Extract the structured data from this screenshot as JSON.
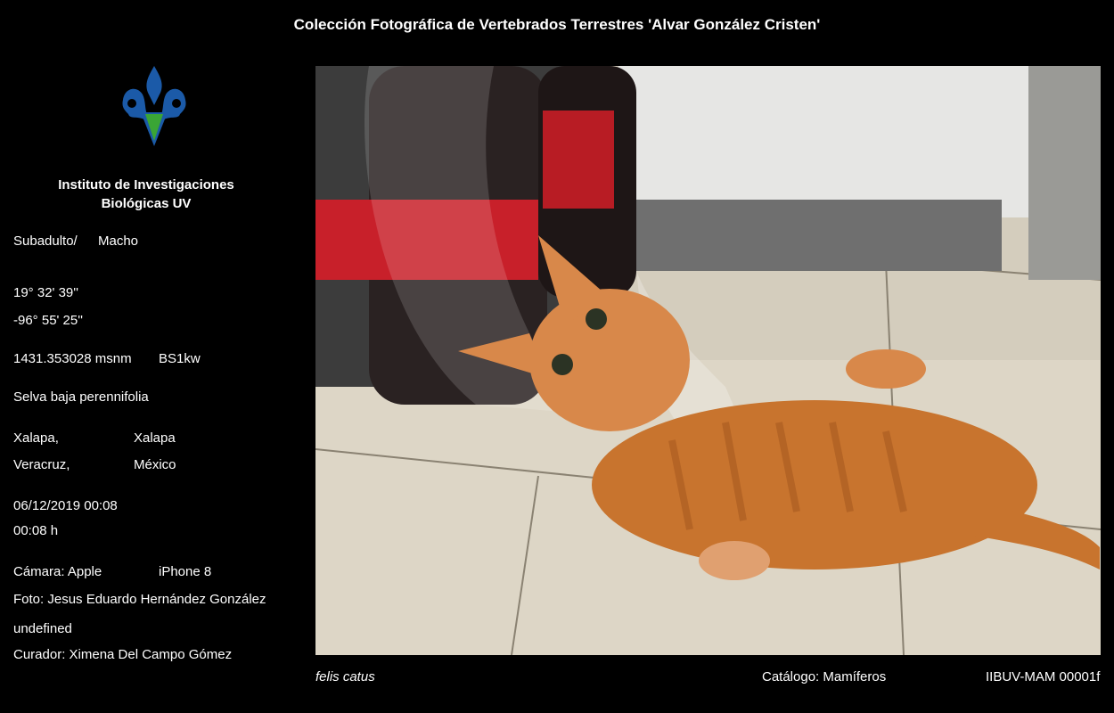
{
  "header": {
    "title": "Colección Fotográfica de Vertebrados Terrestres 'Alvar González Cristen'"
  },
  "sidebar": {
    "institute_line1": "Instituto de Investigaciones",
    "institute_line2": "Biológicas UV",
    "age": "Subadulto/",
    "sex": "Macho",
    "latitude": "19° 32' 39''",
    "longitude": "-96° 55' 25''",
    "altitude": "1431.353028 msnm",
    "climate": "BS1kw",
    "vegetation": "Selva baja perennifolia",
    "locality": "Xalapa,",
    "municipality": "Xalapa",
    "state": "Veracruz,",
    "country": "México",
    "datetime": "06/12/2019 00:08",
    "time": "00:08 h",
    "camera_label": "Cámara: Apple",
    "camera_model": "iPhone 8",
    "photographer": "Foto: Jesus Eduardo Hernández González",
    "extra": "undefined",
    "curator": "Curador: Ximena Del Campo Gómez"
  },
  "footer": {
    "species": "felis catus",
    "catalog": "Catálogo: Mamíferos",
    "catalog_id": "IIBUV-MAM 00001f"
  },
  "colors": {
    "background": "#000000",
    "logo_blue": "#1b5aa8",
    "logo_green": "#3aa535"
  }
}
